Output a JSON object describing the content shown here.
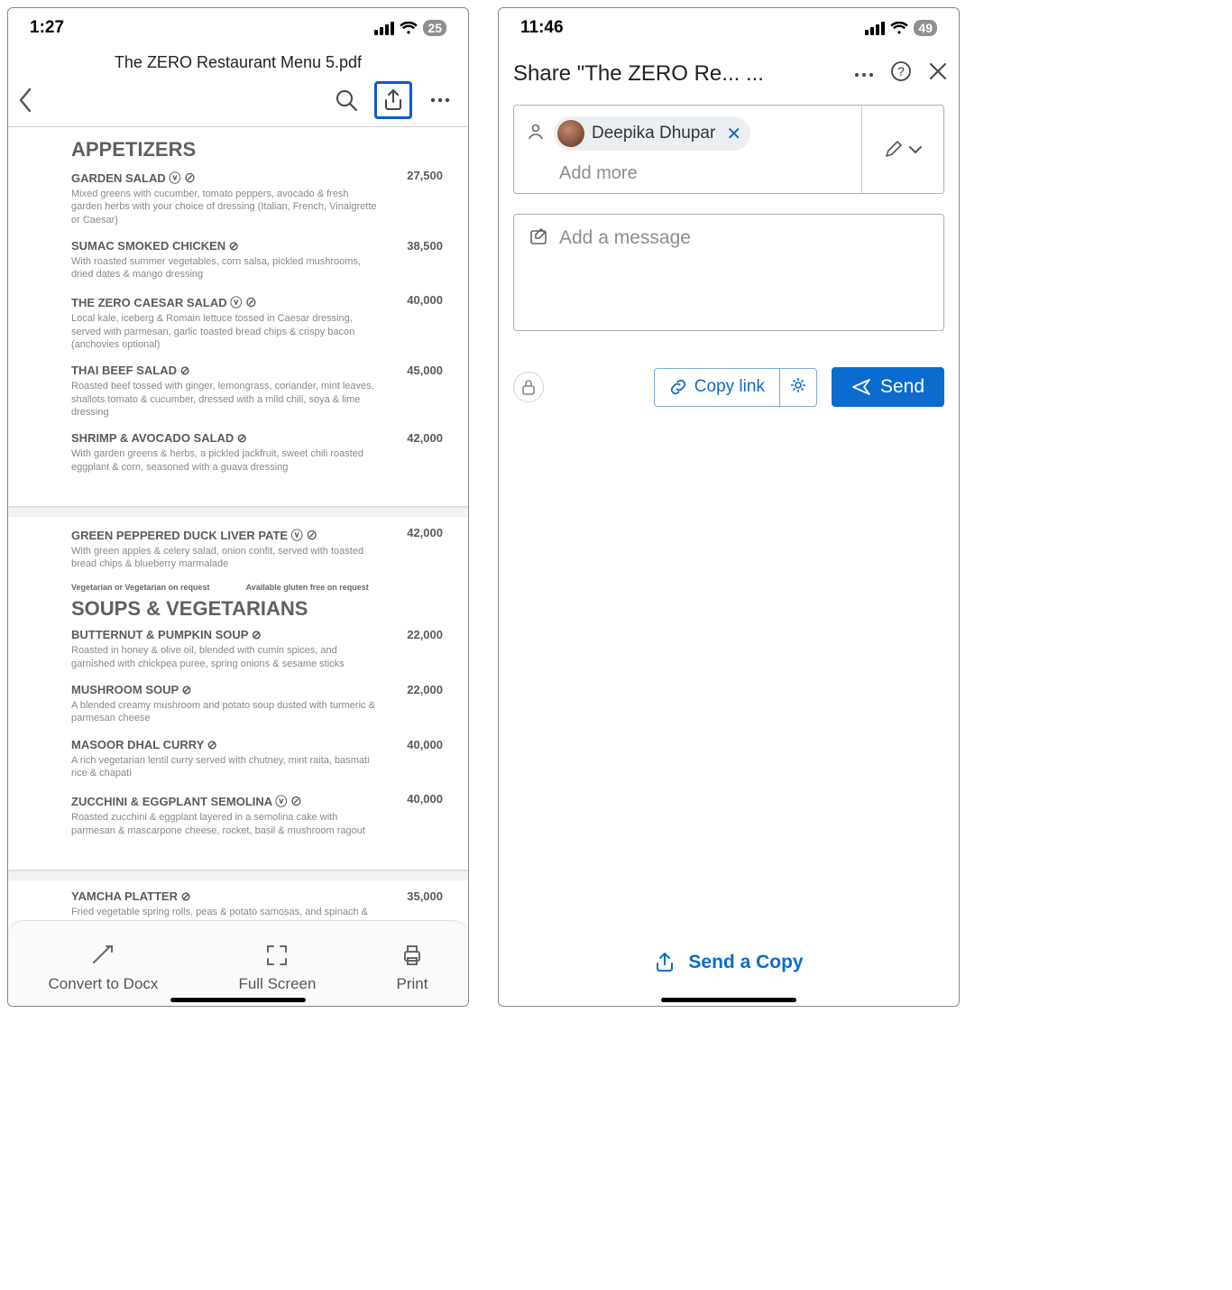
{
  "left": {
    "status": {
      "time": "1:27",
      "battery": "25"
    },
    "doc_title": "The ZERO Restaurant Menu 5.pdf",
    "section_appetizers": "APPETIZERS",
    "section_soups": "SOUPS & VEGETARIANS",
    "meta_veg": "Vegetarian or Vegetarian on request",
    "meta_gf": "Available gluten free on request",
    "items": [
      {
        "name": "GARDEN SALAD ⓥ ⊘",
        "desc": "Mixed greens with cucumber, tomato peppers, avocado & fresh garden herbs with your choice of dressing (Italian, French, Vinaigrette or Caesar)",
        "price": "27,500"
      },
      {
        "name": "SUMAC SMOKED CHICKEN ⊘",
        "desc": "With roasted summer vegetables, corn salsa, pickled mushrooms, dried dates & mango dressing",
        "price": "38,500"
      },
      {
        "name": "THE ZERO CAESAR SALAD ⓥ ⊘",
        "desc": "Local kale, iceberg & Romain lettuce tossed in Caesar dressing, served with parmesan, garlic toasted bread chips & crispy bacon (anchovies optional)",
        "price": "40,000"
      },
      {
        "name": "THAI BEEF SALAD ⊘",
        "desc": "Roasted beef tossed with ginger, lemongrass, coriander, mint leaves, shallots tomato & cucumber, dressed with a mild chili, soya & lime dressing",
        "price": "45,000"
      },
      {
        "name": "SHRIMP & AVOCADO SALAD ⊘",
        "desc": "With garden greens & herbs, a pickled jackfruit, sweet chili roasted eggplant & corn, seasoned with a guava dressing",
        "price": "42,000"
      },
      {
        "name": "GREEN PEPPERED DUCK LIVER PATE ⓥ ⊘",
        "desc": "With green apples & celery salad, onion confit, served with toasted bread chips & blueberry marmalade",
        "price": "42,000"
      },
      {
        "name": "BUTTERNUT & PUMPKIN SOUP ⊘",
        "desc": "Roasted in honey & olive oil, blended with cumin spices, and garnished with chickpea puree, spring onions & sesame sticks",
        "price": "22,000"
      },
      {
        "name": "MUSHROOM SOUP ⊘",
        "desc": "A blended creamy mushroom and potato soup dusted with turmeric & parmesan cheese",
        "price": "22,000"
      },
      {
        "name": "MASOOR DHAL CURRY ⊘",
        "desc": "A rich vegetarian lentil curry served with chutney, mint raita, basmati rice & chapati",
        "price": "40,000"
      },
      {
        "name": "ZUCCHINI & EGGPLANT SEMOLINA ⓥ ⊘",
        "desc": "Roasted zucchini & eggplant layered in a semolina cake with parmesan & mascarpone cheese, rocket, basil & mushroom ragout",
        "price": "40,000"
      },
      {
        "name": "YAMCHA PLATTER ⊘",
        "desc": "Fried vegetable spring rolls, peas & potato samosas, and spinach & cheese savories, served with a sweet chilli & mint yoghurt",
        "price": "35,000"
      }
    ],
    "bottom": {
      "convert": "Convert to Docx",
      "fullscreen": "Full Screen",
      "print": "Print"
    }
  },
  "right": {
    "status": {
      "time": "11:46",
      "battery": "49"
    },
    "title": "Share \"The ZERO Re... ...",
    "recipient": {
      "name": "Deepika Dhupar"
    },
    "add_more": "Add more",
    "message_placeholder": "Add a message",
    "copy_link": "Copy link",
    "send": "Send",
    "send_copy": "Send a Copy"
  }
}
